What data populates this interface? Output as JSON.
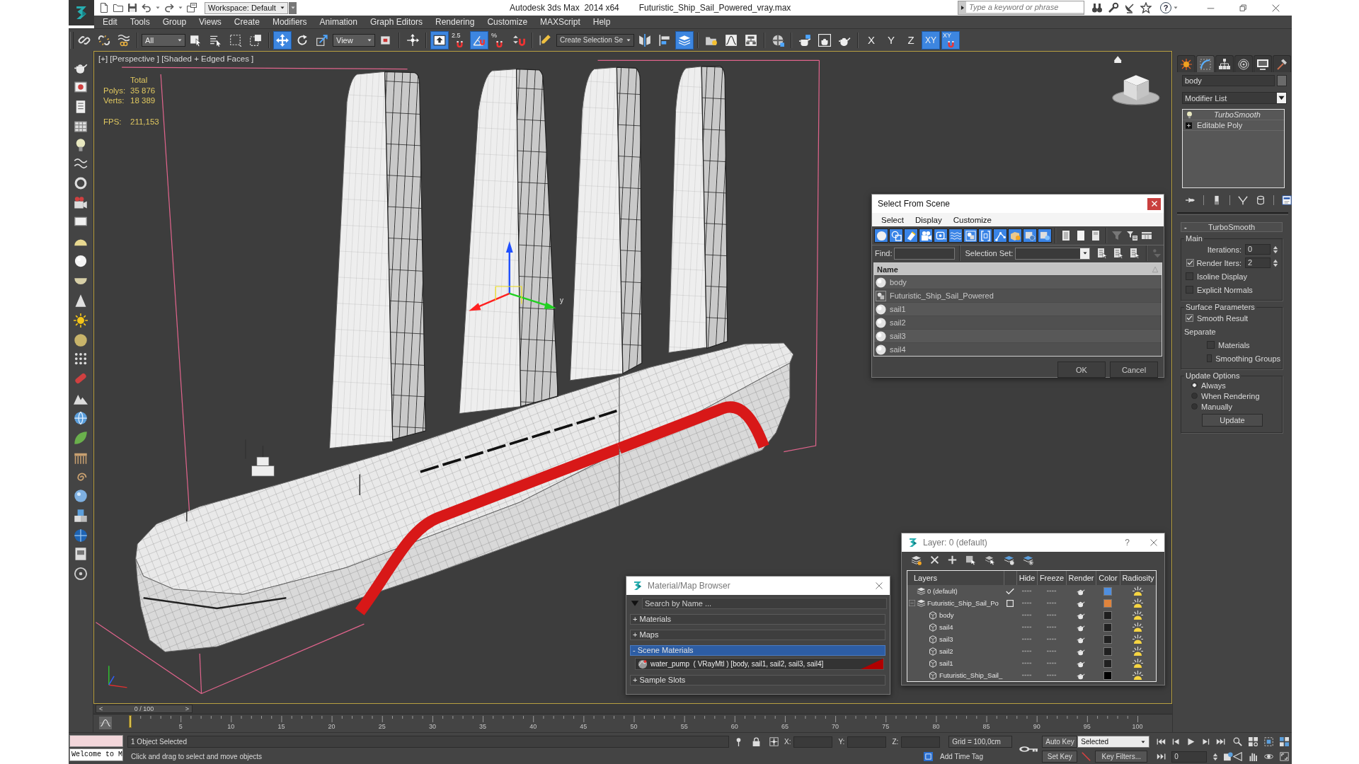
{
  "title_bar": {
    "workspace": "Workspace: Default",
    "app_title": "Autodesk 3ds Max  2014 x64",
    "file_name": "Futuristic_Ship_Sail_Powered_vray.max",
    "search": {
      "placeholder": "Type a keyword or phrase"
    },
    "help": "?"
  },
  "menu_bar": [
    "Edit",
    "Tools",
    "Group",
    "Views",
    "Create",
    "Modifiers",
    "Animation",
    "Graph Editors",
    "Rendering",
    "Customize",
    "MAXScript",
    "Help"
  ],
  "main_toolbar": [
    {
      "kind": "button",
      "on": false
    },
    {
      "kind": "button",
      "on": false
    },
    {
      "kind": "button",
      "on": false
    },
    {
      "kind": "dropdown",
      "value": "All"
    },
    {
      "kind": "button",
      "on": false
    },
    {
      "kind": "button",
      "on": false
    },
    {
      "kind": "button",
      "on": false
    },
    {
      "kind": "button",
      "on": false
    },
    {
      "kind": "button",
      "on": true
    },
    {
      "kind": "button",
      "on": false
    },
    {
      "kind": "button",
      "on": false
    },
    {
      "kind": "dropdown",
      "value": "View"
    },
    {
      "kind": "button",
      "on": false
    },
    {
      "kind": "button",
      "on": false
    },
    {
      "kind": "button",
      "on": true
    },
    {
      "kind": "button",
      "on": false,
      "label": "2.5"
    },
    {
      "kind": "button",
      "on": true
    },
    {
      "kind": "button",
      "on": false,
      "label": "%"
    },
    {
      "kind": "button",
      "on": false
    },
    {
      "kind": "button",
      "on": false
    },
    {
      "kind": "dropdown",
      "value": "Create Selection Se"
    },
    {
      "kind": "button",
      "on": false
    },
    {
      "kind": "button",
      "on": false
    },
    {
      "kind": "button",
      "on": true
    },
    {
      "kind": "button",
      "on": false
    },
    {
      "kind": "button",
      "on": false
    },
    {
      "kind": "button",
      "on": false
    },
    {
      "kind": "button",
      "on": false
    },
    {
      "kind": "button",
      "on": false
    },
    {
      "kind": "button",
      "on": false
    },
    {
      "kind": "button",
      "on": false
    },
    {
      "kind": "text",
      "label": "X",
      "on": false
    },
    {
      "kind": "text",
      "label": "Y",
      "on": false
    },
    {
      "kind": "text",
      "label": "Z",
      "on": false
    },
    {
      "kind": "text",
      "label": "XY",
      "on": true
    },
    {
      "kind": "button",
      "label": "XY",
      "on": true
    }
  ],
  "viewport": {
    "label": "[+] [Perspective ] [Shaded + Edged Faces ]",
    "stats": {
      "title": "Total",
      "rows": [
        {
          "label": "Polys:",
          "value": "35 876"
        },
        {
          "label": "Verts:",
          "value": "18 389"
        },
        {
          "label": "FPS:",
          "value": "211,153"
        }
      ]
    },
    "gizmo_label": "y"
  },
  "select_from_scene": {
    "title": "Select From Scene",
    "menu": [
      "Select",
      "Display",
      "Customize"
    ],
    "filters": [
      {
        "on": true
      },
      {
        "on": true
      },
      {
        "on": true
      },
      {
        "on": true
      },
      {
        "on": true
      },
      {
        "on": true
      },
      {
        "on": true
      },
      {
        "on": true
      },
      {
        "on": true
      },
      {
        "on": true
      },
      {
        "on": true
      },
      {
        "on": true
      }
    ],
    "find": {
      "label": "Find:"
    },
    "selection_set": {
      "label": "Selection Set:"
    },
    "column": "Name",
    "rows": [
      {
        "name": "body",
        "kind": "geometry"
      },
      {
        "name": "Futuristic_Ship_Sail_Powered",
        "kind": "group"
      },
      {
        "name": "sail1",
        "kind": "geometry"
      },
      {
        "name": "sail2",
        "kind": "geometry"
      },
      {
        "name": "sail3",
        "kind": "geometry"
      },
      {
        "name": "sail4",
        "kind": "geometry"
      }
    ],
    "buttons": [
      "OK",
      "Cancel"
    ]
  },
  "material_browser": {
    "title": "Material/Map Browser",
    "search": {
      "placeholder": "Search by Name ..."
    },
    "sections": [
      {
        "label": "+ Materials",
        "selected": false
      },
      {
        "label": "+ Maps",
        "selected": false
      },
      {
        "label": "- Scene Materials",
        "selected": true,
        "items": [
          {
            "label": "water_pump  ( VRayMtl ) [body, sail1, sail2, sail3, sail4]"
          }
        ]
      },
      {
        "label": "+ Sample Slots",
        "selected": false
      }
    ]
  },
  "layer_manager": {
    "title": "Layer: 0 (default)",
    "help": "?",
    "columns": [
      "Layers",
      "Hide",
      "Freeze",
      "Render",
      "Color",
      "Radiosity"
    ],
    "rows": [
      {
        "name": "0 (default)",
        "current": true,
        "hide": false,
        "freeze": false,
        "color": "#4f8fe0"
      },
      {
        "name": "Futuristic_Ship_Sail_Po",
        "current": false,
        "hide": false,
        "freeze": false,
        "color": "#e0843c",
        "expanded": true,
        "children": [
          {
            "name": "body",
            "hide": false,
            "freeze": false,
            "color": "#202020"
          },
          {
            "name": "sail4",
            "hide": false,
            "freeze": false,
            "color": "#202020"
          },
          {
            "name": "sail3",
            "hide": false,
            "freeze": false,
            "color": "#202020"
          },
          {
            "name": "sail2",
            "hide": false,
            "freeze": false,
            "color": "#202020"
          },
          {
            "name": "sail1",
            "hide": false,
            "freeze": false,
            "color": "#202020"
          },
          {
            "name": "Futuristic_Ship_Sail_",
            "hide": false,
            "freeze": false,
            "color": "#000000"
          }
        ]
      }
    ]
  },
  "command_panel": {
    "tabs": [
      {
        "selected": false
      },
      {
        "selected": true
      },
      {
        "selected": false
      },
      {
        "selected": false
      },
      {
        "selected": false
      },
      {
        "selected": false
      }
    ],
    "object_name": "body",
    "modifier_list": "Modifier List",
    "stack": [
      {
        "label": "TurboSmooth",
        "kind": "modifier"
      },
      {
        "label": "Editable Poly",
        "kind": "object"
      }
    ],
    "rollout": {
      "sign": "-",
      "title": "TurboSmooth",
      "groups": [
        {
          "title": "Main",
          "rows": [
            {
              "kind": "spinner",
              "label": "Iterations:",
              "value": "0"
            },
            {
              "kind": "check_spinner",
              "label": "Render Iters:",
              "value": "2",
              "checked": true
            },
            {
              "kind": "checkbox",
              "label": "Isoline Display",
              "checked": false
            },
            {
              "kind": "checkbox",
              "label": "Explicit Normals",
              "checked": false
            }
          ]
        },
        {
          "title": "Surface Parameters",
          "rows": [
            {
              "kind": "checkbox",
              "label": "Smooth Result",
              "checked": true
            },
            {
              "kind": "text",
              "label": "Separate",
              "children": [
                {
                  "kind": "checkbox",
                  "label": "Materials",
                  "checked": false
                },
                {
                  "kind": "checkbox",
                  "label": "Smoothing Groups",
                  "checked": false
                }
              ]
            }
          ]
        },
        {
          "title": "Update Options",
          "rows": [
            {
              "kind": "radio",
              "label": "Always",
              "selected": true
            },
            {
              "kind": "radio",
              "label": "When Rendering",
              "selected": false
            },
            {
              "kind": "radio",
              "label": "Manually",
              "selected": false
            },
            {
              "kind": "button",
              "label": "Update"
            }
          ]
        }
      ]
    }
  },
  "time_slider": {
    "prev": "<",
    "label": "0 / 100",
    "next": ">"
  },
  "timeline": {
    "ticks": [
      "5",
      "10",
      "15",
      "20",
      "25",
      "30",
      "35",
      "40",
      "45",
      "50",
      "55",
      "60",
      "65",
      "70",
      "75",
      "80",
      "85",
      "90",
      "95",
      "100"
    ]
  },
  "status_bar": {
    "listener": "Welcome to M",
    "selection": "1 Object Selected",
    "prompt": "Click and drag to select and move objects",
    "coords": [
      "X:",
      "Y:",
      "Z:"
    ],
    "grid": "Grid = 100,0cm",
    "add_time_tag": "Add Time Tag",
    "auto_key": "Auto Key",
    "key_mode": "Selected",
    "set_key": "Set Key",
    "key_filters": "Key Filters...",
    "frame": "0"
  }
}
